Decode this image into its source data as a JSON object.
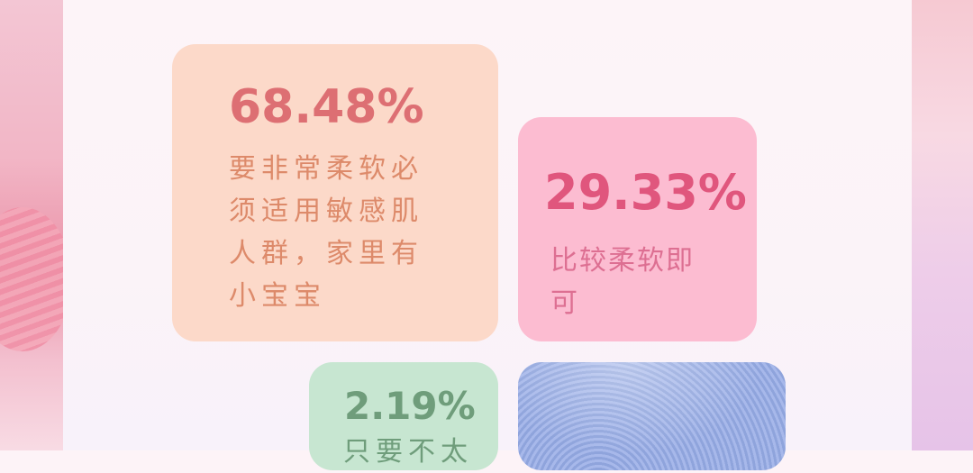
{
  "cards": [
    {
      "percent": "68.48%",
      "text": "要非常柔软必须适用敏感肌人群，家里有小宝宝"
    },
    {
      "percent": "29.33%",
      "text": "比较柔软即可"
    },
    {
      "percent": "2.19%",
      "text": "只要不太"
    }
  ],
  "colors": {
    "card_1": "#fcd9c9",
    "card_2": "#fcbcd1",
    "card_3": "#c7e6d1",
    "card_4": "#9fb2e8"
  }
}
